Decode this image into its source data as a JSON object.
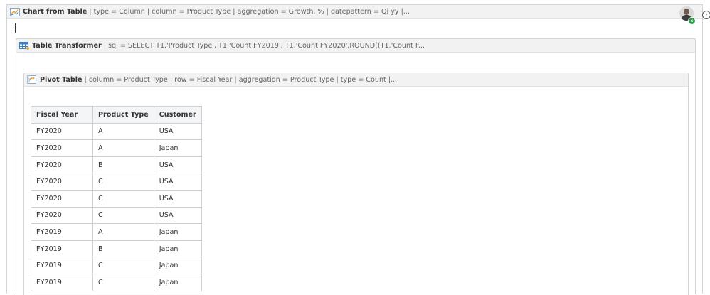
{
  "chart_macro": {
    "title": "Chart from Table",
    "params": "| type = Column | column = Product Type | aggregation = Growth, % | datepattern = Qi yy |..."
  },
  "user": {
    "status_letter": "c"
  },
  "edge_button": "-",
  "transformer_macro": {
    "title": "Table Transformer",
    "params": "| sql = SELECT T1.'Product Type', T1.'Count FY2019', T1.'Count FY2020',ROUND((T1.'Count F..."
  },
  "pivot_macro": {
    "title": "Pivot Table",
    "params": "| column = Product Type | row = Fiscal Year | aggregation = Product Type | type = Count |..."
  },
  "table": {
    "headers": [
      "Fiscal Year",
      "Product Type",
      "Customer"
    ],
    "rows": [
      [
        "FY2020",
        "A",
        "USA"
      ],
      [
        "FY2020",
        "A",
        "Japan"
      ],
      [
        "FY2020",
        "B",
        "USA"
      ],
      [
        "FY2020",
        "C",
        "USA"
      ],
      [
        "FY2020",
        "C",
        "USA"
      ],
      [
        "FY2020",
        "C",
        "USA"
      ],
      [
        "FY2019",
        "A",
        "Japan"
      ],
      [
        "FY2019",
        "B",
        "Japan"
      ],
      [
        "FY2019",
        "C",
        "Japan"
      ],
      [
        "FY2019",
        "C",
        "Japan"
      ]
    ]
  }
}
